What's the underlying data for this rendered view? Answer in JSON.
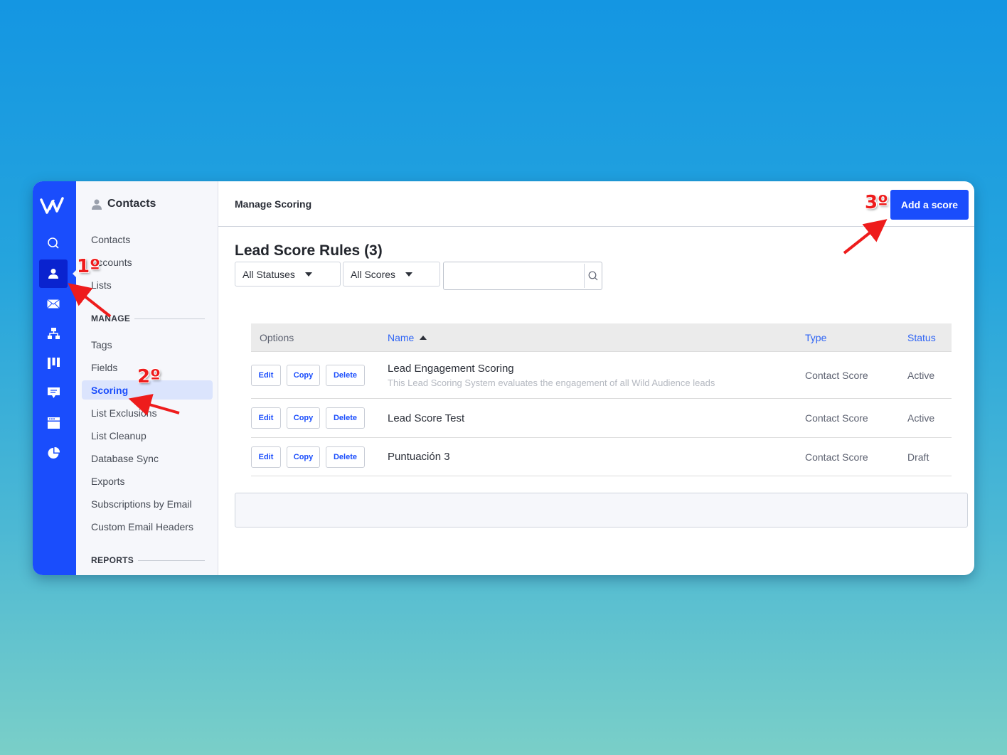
{
  "rail": {
    "logo": "wild-audience-logo",
    "icons": [
      "search-icon",
      "contacts-icon",
      "email-icon",
      "automation-icon",
      "pipeline-icon",
      "messages-icon",
      "landing-page-icon",
      "reports-icon"
    ],
    "active": "contacts-icon"
  },
  "subnav": {
    "title": "Contacts",
    "items_top": [
      "Contacts",
      "Accounts",
      "Lists"
    ],
    "section_manage": "MANAGE",
    "items_manage": [
      "Tags",
      "Fields",
      "Scoring",
      "List Exclusions",
      "List Cleanup",
      "Database Sync",
      "Exports",
      "Subscriptions by Email",
      "Custom Email Headers"
    ],
    "active_item": "Scoring",
    "section_reports": "REPORTS"
  },
  "topbar": {
    "breadcrumb": "Manage Scoring",
    "add_button": "Add a score"
  },
  "page": {
    "title": "Lead Score Rules (3)",
    "filters": {
      "status": "All Statuses",
      "score": "All Scores",
      "search_value": ""
    }
  },
  "table": {
    "headers": {
      "options": "Options",
      "name": "Name",
      "type": "Type",
      "status": "Status"
    },
    "sort": {
      "column": "Name",
      "direction": "ascending"
    },
    "row_buttons": {
      "edit": "Edit",
      "copy": "Copy",
      "delete": "Delete"
    },
    "rows": [
      {
        "name": "Lead Engagement Scoring",
        "description": "This Lead Scoring System evaluates the engagement of all Wild Audience leads",
        "type": "Contact Score",
        "status": "Active"
      },
      {
        "name": "Lead Score Test",
        "description": "",
        "type": "Contact Score",
        "status": "Active"
      },
      {
        "name": "Puntuación 3",
        "description": "",
        "type": "Contact Score",
        "status": "Draft"
      }
    ]
  },
  "annotations": {
    "step1": "1º",
    "step2": "2º",
    "step3": "3º"
  },
  "colors": {
    "accent": "#1a4dfc",
    "annotation": "#ee1c1c"
  }
}
